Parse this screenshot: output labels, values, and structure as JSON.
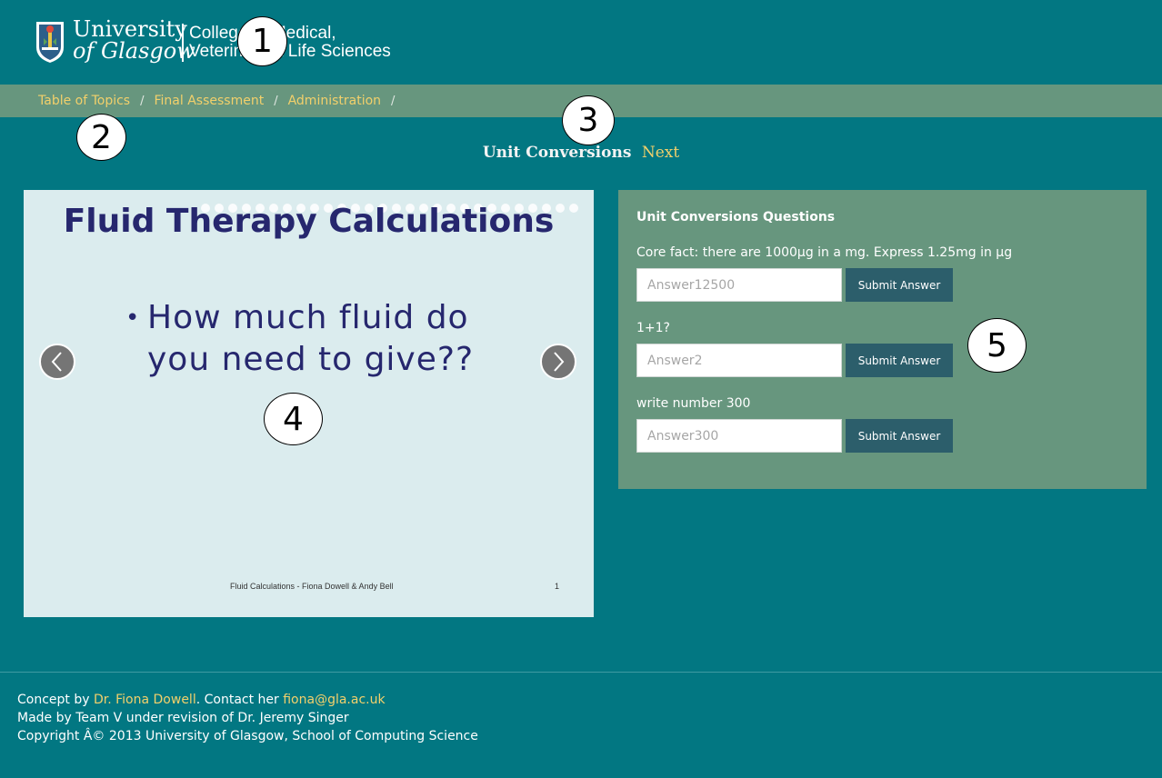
{
  "header": {
    "logo": {
      "university_line1": "University",
      "university_line2": "of Glasgow",
      "college_line1": "College of Medical,",
      "college_line2": "Veterinary & Life Sciences"
    }
  },
  "breadcrumb": {
    "items": [
      {
        "label": "Table of Topics"
      },
      {
        "label": "Final Assessment"
      },
      {
        "label": "Administration"
      }
    ],
    "separator": "/"
  },
  "title": {
    "text": "Unit Conversions",
    "next_label": "Next"
  },
  "slide": {
    "title": "Fluid Therapy Calculations",
    "bullet_line1": "How much fluid do",
    "bullet_line2": "you need to give??",
    "bullet_symbol": "•",
    "footer": "Fluid Calculations - Fiona Dowell & Andy Bell",
    "page": "1",
    "dot_count": 28
  },
  "questions": {
    "title": "Unit Conversions Questions",
    "items": [
      {
        "label": "Core fact: there are 1000µg in a mg. Express 1.25mg in µg",
        "placeholder": "Answer12500",
        "button": "Submit Answer"
      },
      {
        "label": "1+1?",
        "placeholder": "Answer2",
        "button": "Submit Answer"
      },
      {
        "label": "write number 300",
        "placeholder": "Answer300",
        "button": "Submit Answer"
      }
    ]
  },
  "footer": {
    "concept_prefix": "Concept by ",
    "author_link": "Dr. Fiona Dowell",
    "contact_prefix": ". Contact her ",
    "email_link": "fiona@gla.ac.uk",
    "made_by": "Made by Team V under revision of Dr. Jeremy Singer",
    "copyright": "Copyright Â© 2013 University of Glasgow, School of Computing Science"
  },
  "markers": [
    "1",
    "2",
    "3",
    "4",
    "5"
  ],
  "colors": {
    "background": "#027782",
    "panel": "#67967e",
    "link": "#f2d06b",
    "button": "#2c5e6b",
    "slide_text": "#26276e"
  }
}
